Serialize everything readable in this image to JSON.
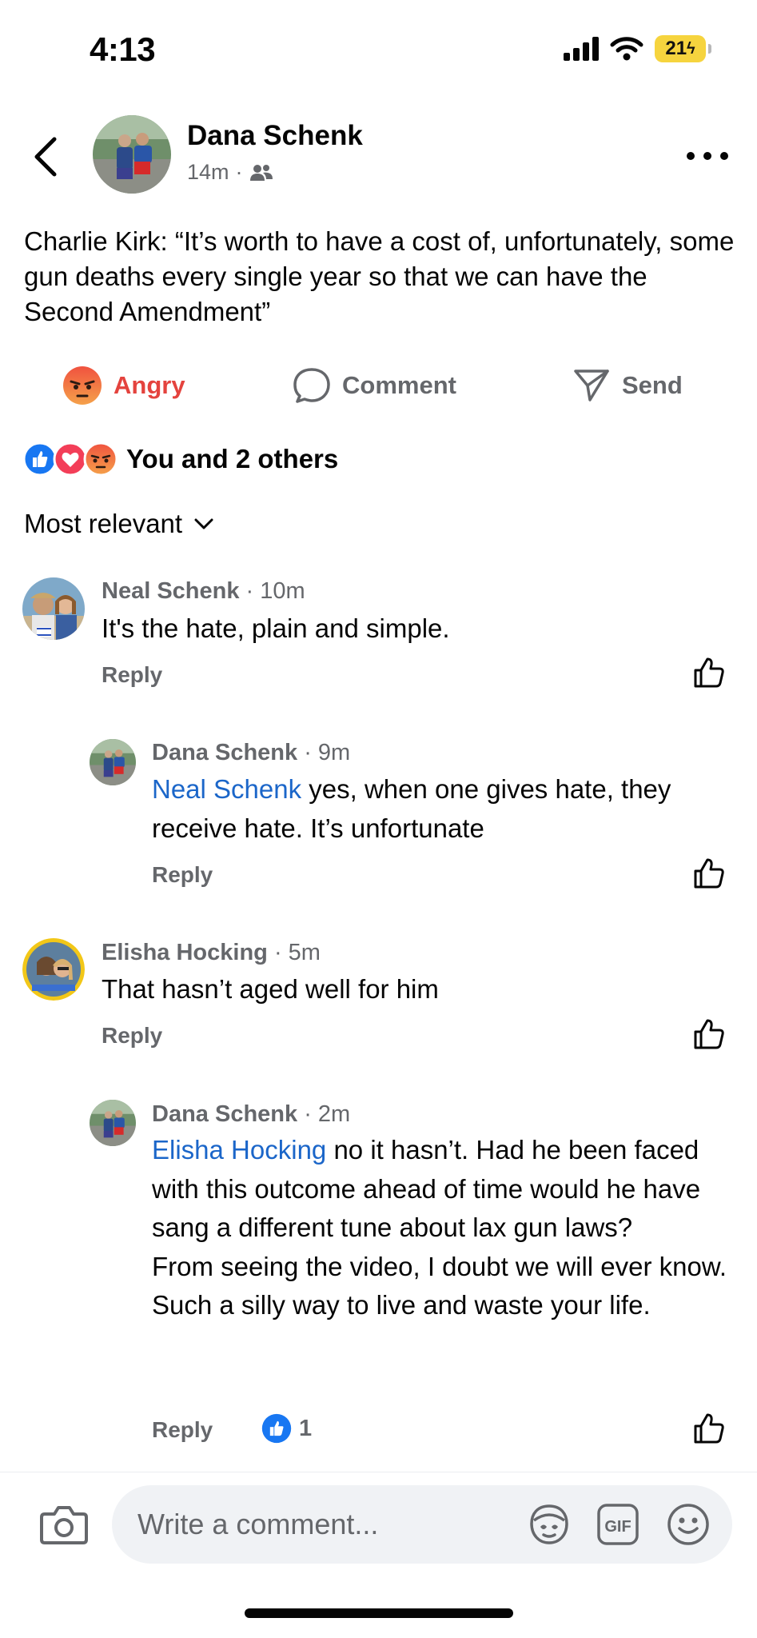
{
  "status_bar": {
    "time": "4:13",
    "battery": "21"
  },
  "post": {
    "author": "Dana Schenk",
    "time": "14m",
    "audience_icon": "friends-icon",
    "text": "Charlie Kirk: “It’s worth to have a cost of, unfortunately, some gun deaths every single year so that we can have the Second Amendment”"
  },
  "actions": {
    "angry": "Angry",
    "comment": "Comment",
    "send": "Send"
  },
  "reactions": {
    "summary": "You and 2 others",
    "icons": [
      "like-icon",
      "love-icon",
      "angry-icon"
    ]
  },
  "sort": {
    "label": "Most relevant"
  },
  "comments": [
    {
      "name": "Neal Schenk",
      "time": "· 10m",
      "text": "It's the hate, plain and simple.",
      "reply": "Reply"
    },
    {
      "name": "Dana Schenk",
      "time": "· 9m",
      "mention": "Neal Schenk",
      "text": " yes, when one gives hate, they receive hate.  It’s unfortunate",
      "reply": "Reply"
    },
    {
      "name": "Elisha Hocking",
      "time": "· 5m",
      "text": "That hasn’t aged well for him",
      "reply": "Reply"
    },
    {
      "name": "Dana Schenk",
      "time": "· 2m",
      "mention": "Elisha Hocking",
      "text": " no it hasn’t.  Had he been faced with this outcome ahead of time would he have sang a different tune about lax gun laws?",
      "text2": "From seeing the video, I doubt we will ever know.  Such a silly way to live and waste your life.",
      "reply": "Reply",
      "likes": "1"
    }
  ],
  "composer": {
    "placeholder": "Write a comment...",
    "icons": [
      "camera-icon",
      "avatar-sticker-icon",
      "gif-icon",
      "emoji-icon"
    ]
  },
  "colors": {
    "accent_blue": "#1b66c9",
    "angry_red": "#e4433e",
    "secondary_text": "#65676b",
    "input_bg": "#f0f2f5",
    "battery_yellow": "#f6d43e"
  }
}
